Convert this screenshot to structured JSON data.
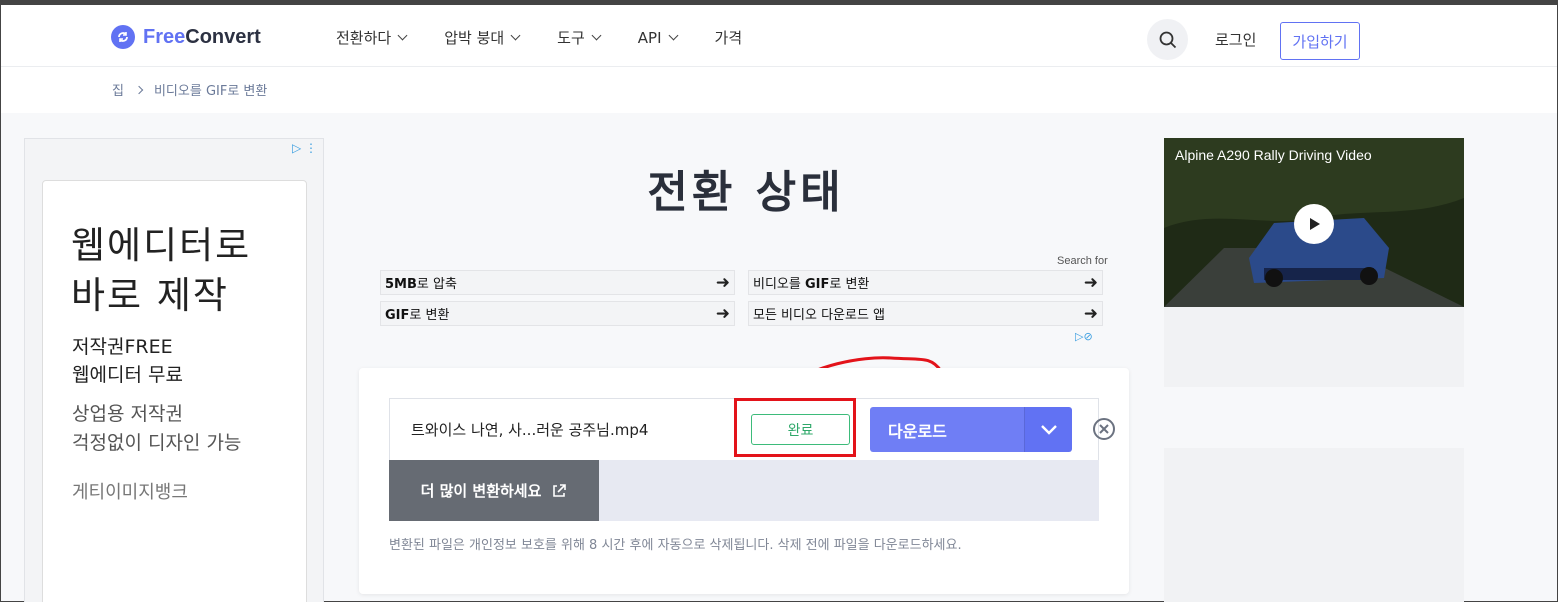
{
  "header": {
    "logo_text_free": "Free",
    "logo_text_convert": "Convert",
    "nav": [
      {
        "label": "전환하다",
        "dropdown": true
      },
      {
        "label": "압박 붕대",
        "dropdown": true
      },
      {
        "label": "도구",
        "dropdown": true
      },
      {
        "label": "API",
        "dropdown": true
      },
      {
        "label": "가격",
        "dropdown": false
      }
    ],
    "login": "로그인",
    "signup": "가입하기"
  },
  "breadcrumb": {
    "home": "집",
    "current": "비디오를 GIF로 변환"
  },
  "left_ad": {
    "headline": "웹에디터로\n바로 제작",
    "line2": "저작권FREE\n웹에디터 무료",
    "line3": "상업용 저작권\n걱정없이 디자인 가능",
    "brand": "게티이미지뱅크"
  },
  "main": {
    "title": "전환 상태",
    "search_for": "Search for",
    "ad_links": [
      {
        "bold": "5MB",
        "rest": "로 압축"
      },
      {
        "bold": "",
        "rest": "비디오를 ",
        "bold2": "GIF",
        "rest2": "로 변환"
      },
      {
        "bold": "GIF",
        "rest": "로 변환"
      },
      {
        "bold": "",
        "rest": "모든 비디오 다운로드 앱"
      }
    ]
  },
  "conversion": {
    "file_name": "트와이스 나연, 사...러운 공주님.mp4",
    "status": "완료",
    "download_label": "다운로드",
    "more_label": "더 많이 변환하세요",
    "note": "변환된 파일은 개인정보 보호를 위해 8 시간 후에 자동으로 삭제됩니다. 삭제 전에 파일을 다운로드하세요."
  },
  "video_ad": {
    "title": "Alpine A290 Rally Driving Video"
  },
  "colors": {
    "accent": "#6172f3",
    "success": "#3dbb7a",
    "highlight": "#e3131a"
  }
}
